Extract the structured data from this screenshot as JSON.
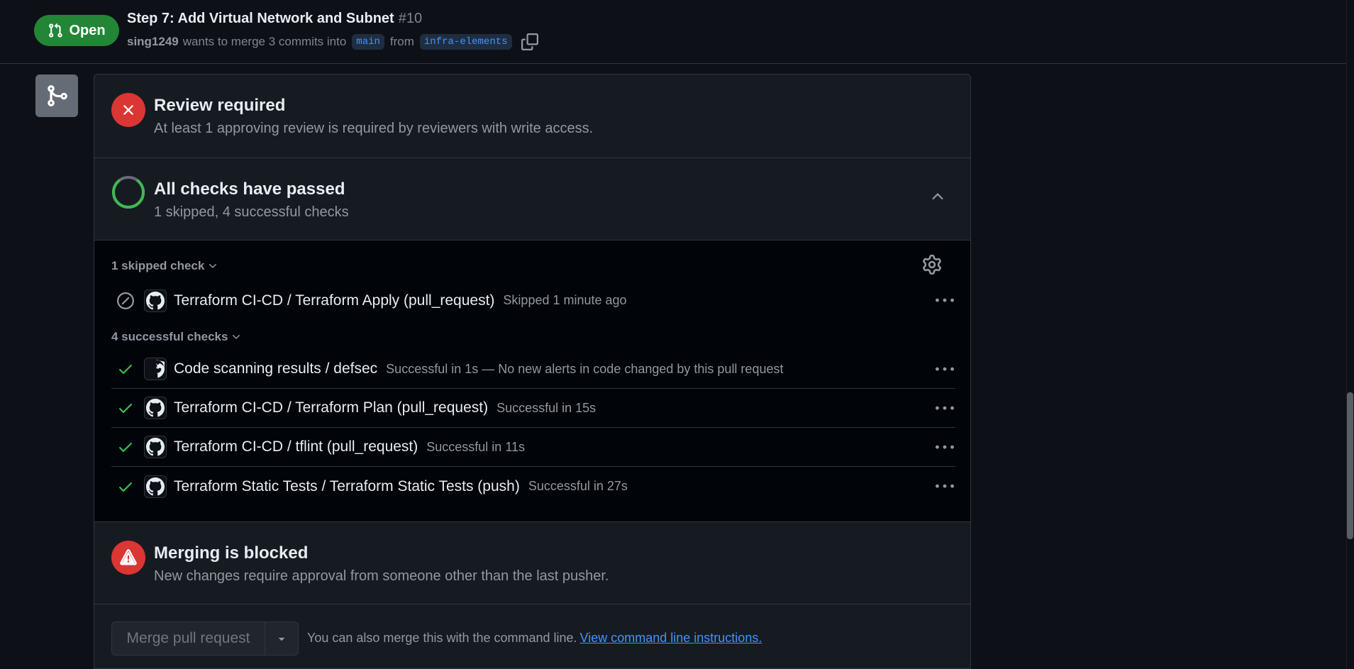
{
  "header": {
    "status_label": "Open",
    "title": "Step 7: Add Virtual Network and Subnet",
    "number": "#10",
    "author": "sing1249",
    "merge_text": "wants to merge 3 commits into",
    "base_branch": "main",
    "from_text": "from",
    "head_branch": "infra-elements",
    "copy_icon": "copy-icon"
  },
  "review": {
    "title": "Review required",
    "description": "At least 1 approving review is required by reviewers with write access.",
    "icon": "x-icon"
  },
  "checks_summary": {
    "title": "All checks have passed",
    "description": "1 skipped, 4 successful checks",
    "icon": "progress-ring-icon"
  },
  "skipped_group": {
    "label": "1 skipped check",
    "checks": [
      {
        "name": "Terraform CI-CD / Terraform Apply (pull_request)",
        "meta": "Skipped 1 minute ago",
        "status": "skipped"
      }
    ]
  },
  "successful_group": {
    "label": "4 successful checks",
    "checks": [
      {
        "name": "Code scanning results / defsec",
        "meta": "Successful in 1s — No new alerts in code changed by this pull request",
        "status": "success"
      },
      {
        "name": "Terraform CI-CD / Terraform Plan (pull_request)",
        "meta": "Successful in 15s",
        "status": "success"
      },
      {
        "name": "Terraform CI-CD / tflint (pull_request)",
        "meta": "Successful in 11s",
        "status": "success"
      },
      {
        "name": "Terraform Static Tests / Terraform Static Tests (push)",
        "meta": "Successful in 27s",
        "status": "success"
      }
    ]
  },
  "blocked": {
    "title": "Merging is blocked",
    "description": "New changes require approval from someone other than the last pusher.",
    "icon": "alert-icon"
  },
  "merge": {
    "button_label": "Merge pull request",
    "cmd_text": "You can also merge this with the command line.",
    "cmd_link": "View command line instructions."
  },
  "colors": {
    "background": "#0d1117",
    "open_green": "#238636",
    "danger_red": "#da3633",
    "success_green": "#3fb950",
    "link_blue": "#4493f8",
    "muted_text": "#9198a1"
  }
}
